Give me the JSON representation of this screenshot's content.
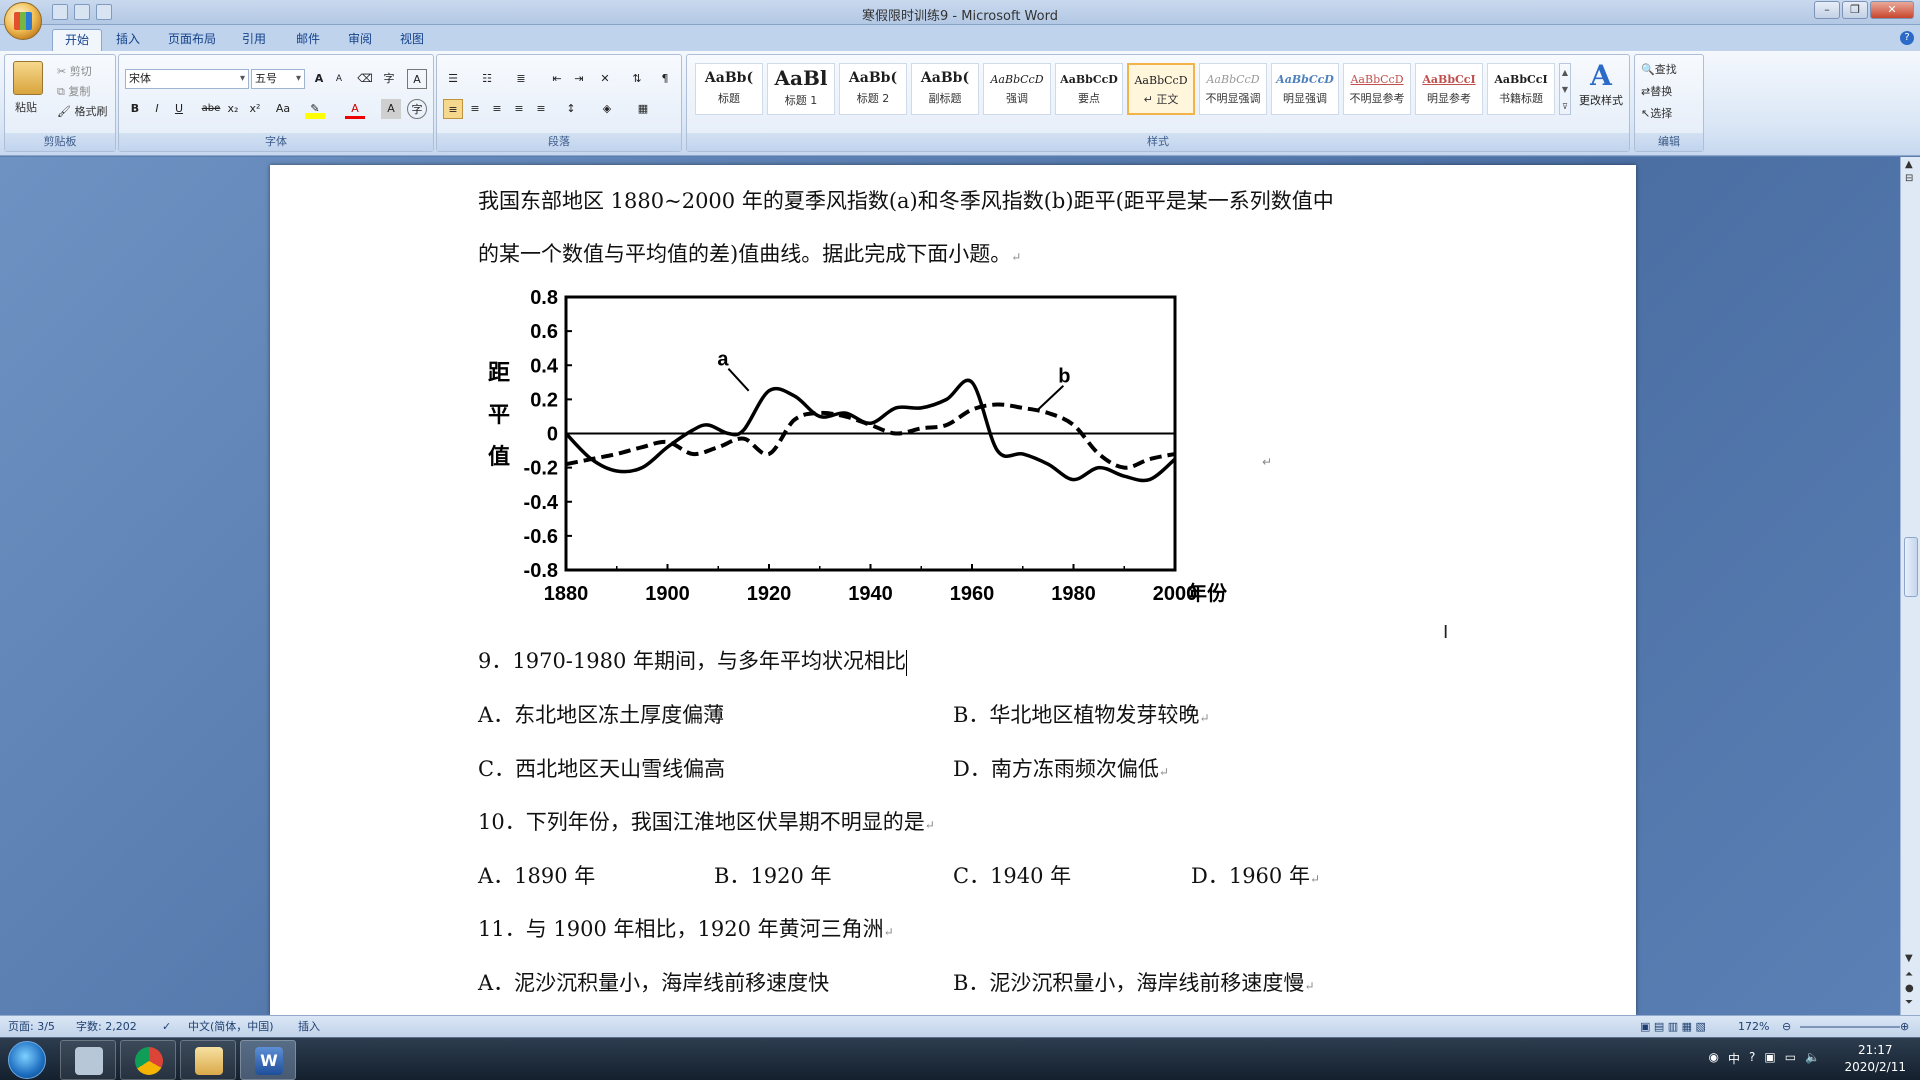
{
  "window": {
    "title": "寒假限时训练9 - Microsoft Word"
  },
  "ribbon": {
    "tabs": [
      "开始",
      "插入",
      "页面布局",
      "引用",
      "邮件",
      "审阅",
      "视图"
    ],
    "clipboard": {
      "paste": "粘贴",
      "cut": "剪切",
      "copy": "复制",
      "format_painter": "格式刷",
      "label": "剪贴板"
    },
    "font": {
      "name": "宋体",
      "size": "五号",
      "label": "字体",
      "bold": "B",
      "italic": "I",
      "underline": "U",
      "strike": "abe",
      "sub": "x₂",
      "sup": "x²",
      "case": "Aa",
      "grow": "A",
      "shrink": "A",
      "color_a": "A",
      "char_shade": "A",
      "enclose": "字"
    },
    "paragraph": {
      "label": "段落"
    },
    "styles": {
      "label": "样式",
      "change_styles": "更改样式",
      "items": [
        {
          "sample": "AaBb(",
          "name": "标题"
        },
        {
          "sample": "AaBl",
          "name": "标题 1"
        },
        {
          "sample": "AaBb(",
          "name": "标题 2"
        },
        {
          "sample": "AaBb(",
          "name": "副标题"
        },
        {
          "sample": "AaBbCcD",
          "name": "强调"
        },
        {
          "sample": "AaBbCcD",
          "name": "要点"
        },
        {
          "sample": "AaBbCcD",
          "name": "↵ 正文"
        },
        {
          "sample": "AaBbCcD",
          "name": "不明显强调"
        },
        {
          "sample": "AaBbCcD",
          "name": "明显强调"
        },
        {
          "sample": "AaBbCcD",
          "name": "不明显参考"
        },
        {
          "sample": "AaBbCcI",
          "name": "明显参考"
        },
        {
          "sample": "AaBbCcI",
          "name": "书籍标题"
        }
      ]
    },
    "editing": {
      "label": "编辑",
      "find": "查找",
      "replace": "替换",
      "select": "选择"
    }
  },
  "document": {
    "intro_line1": "我国东部地区 1880~2000 年的夏季风指数(a)和冬季风指数(b)距平(距平是某一系列数值中",
    "intro_line2": "的某一个数值与平均值的差)值曲线。据此完成下面小题。",
    "q9": "9．1970-1980 年期间，与多年平均状况相比",
    "q9_a": "A．东北地区冻土厚度偏薄",
    "q9_b": "B．华北地区植物发芽较晚",
    "q9_c": "C．西北地区天山雪线偏高",
    "q9_d": "D．南方冻雨频次偏低",
    "q10": "10．下列年份，我国江淮地区伏旱期不明显的是",
    "q10_a": "A．1890 年",
    "q10_b": "B．1920 年",
    "q10_c": "C．1940 年",
    "q10_d": "D．1960 年",
    "q11": "11．与 1900 年相比，1920 年黄河三角洲",
    "q11_a": "A．泥沙沉积量小，海岸线前移速度快",
    "q11_b": "B．泥沙沉积量小，海岸线前移速度慢"
  },
  "chart_data": {
    "type": "line",
    "title": "",
    "ylabel": "距平值",
    "xlabel": "年份",
    "xlim": [
      1880,
      2000
    ],
    "ylim": [
      -0.8,
      0.8
    ],
    "x_ticks": [
      "1880",
      "1900",
      "1920",
      "1940",
      "1960",
      "1980",
      "2000"
    ],
    "y_ticks": [
      "0.8",
      "0.6",
      "0.4",
      "0.2",
      "0",
      "-0.2",
      "-0.4",
      "-0.6",
      "-0.8"
    ],
    "x_unit_label": "年份",
    "series": [
      {
        "name": "a",
        "style": "solid",
        "x": [
          1880,
          1885,
          1890,
          1895,
          1900,
          1905,
          1908,
          1912,
          1915,
          1920,
          1925,
          1930,
          1935,
          1940,
          1945,
          1950,
          1955,
          1960,
          1965,
          1970,
          1975,
          1980,
          1985,
          1990,
          1995,
          2000
        ],
        "y": [
          0.0,
          -0.15,
          -0.22,
          -0.2,
          -0.08,
          0.02,
          0.05,
          0.0,
          0.02,
          0.25,
          0.22,
          0.1,
          0.12,
          0.06,
          0.15,
          0.15,
          0.2,
          0.3,
          -0.1,
          -0.12,
          -0.18,
          -0.27,
          -0.2,
          -0.25,
          -0.27,
          -0.15
        ]
      },
      {
        "name": "b",
        "style": "dashed",
        "x": [
          1880,
          1885,
          1890,
          1895,
          1900,
          1905,
          1910,
          1915,
          1920,
          1925,
          1930,
          1935,
          1940,
          1945,
          1950,
          1955,
          1960,
          1965,
          1970,
          1975,
          1980,
          1985,
          1990,
          1995,
          2000
        ],
        "y": [
          -0.18,
          -0.15,
          -0.12,
          -0.08,
          -0.05,
          -0.12,
          -0.08,
          -0.03,
          -0.12,
          0.08,
          0.12,
          0.1,
          0.05,
          0.0,
          0.03,
          0.05,
          0.14,
          0.17,
          0.15,
          0.12,
          0.05,
          -0.12,
          -0.2,
          -0.15,
          -0.12
        ]
      }
    ]
  },
  "status": {
    "page": "页面: 3/5",
    "words": "字数: 2,202",
    "language": "中文(简体，中国)",
    "mode": "插入",
    "zoom": "172%"
  },
  "taskbar": {
    "time": "21:17",
    "date": "2020/2/11",
    "ime": "中"
  }
}
